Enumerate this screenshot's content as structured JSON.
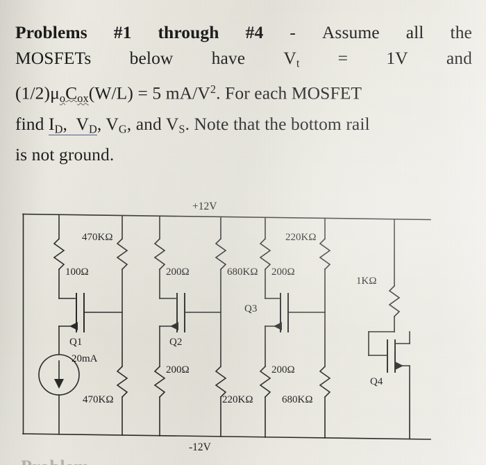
{
  "statement": {
    "line1_bold": "Problems #1 through #4",
    "line1_rest": "- Assume all the",
    "line2": "MOSFETs below have Vt = 1V and",
    "line3": "(1/2)μoCox(W/L) = 5 mA/V². For each MOSFET",
    "line4": "find ID, VD, VG, and VS. Note that the bottom rail",
    "line5": "is not ground.",
    "tokens": {
      "problems": "Problems",
      "hash1": "#1",
      "through": "through",
      "hash4": "#4",
      "dash": "-",
      "assume": "Assume",
      "all": "all",
      "the": "the",
      "mosfets": "MOSFETs",
      "below": "below",
      "have": "have",
      "v": "V",
      "t_sub": "t",
      "equals": "=",
      "one_volt": "1V",
      "and": "and",
      "half_mu": "(1/2)μ",
      "o_sub": "o",
      "c_big": "C",
      "ox_sub": "ox",
      "wl": "(W/L)",
      "five_ma": "5 mA/V",
      "sq": "2",
      "period_for_each": ". For each MOSFET",
      "find": "find",
      "i_d": "I",
      "d_sub": "D",
      "comma": ",",
      "v_d": "V",
      "v_g": "V",
      "g_sub": "G",
      "and2": "and",
      "v_s": "V",
      "s_sub": "S",
      "note": ". Note that the bottom rail",
      "isnot": "is not ground."
    }
  },
  "circuit": {
    "rail_top": "+12V",
    "rail_bottom": "-12V",
    "labels": {
      "r_100": "100Ω",
      "r_470k_top": "470KΩ",
      "r_470k_bot": "470KΩ",
      "r_200_q2_top": "200Ω",
      "r_200_q2_bot": "200Ω",
      "r_680k_top": "680KΩ",
      "r_680k_bot": "680KΩ",
      "r_220k_top": "220KΩ",
      "r_220k_bot": "220KΩ",
      "r_200_q3_top": "200Ω",
      "r_200_q3_bot": "200Ω",
      "r_1k": "1KΩ",
      "q1": "Q1",
      "q2": "Q2",
      "q3": "Q3",
      "q4": "Q4",
      "isrc": "20mA"
    },
    "ink_color": "#2a2a28"
  },
  "bottom_cut_text": "Problem",
  "colors": {
    "paper": "#e7e5dc",
    "ink": "#1b1b1b",
    "underline_blue": "#4a5a86"
  }
}
